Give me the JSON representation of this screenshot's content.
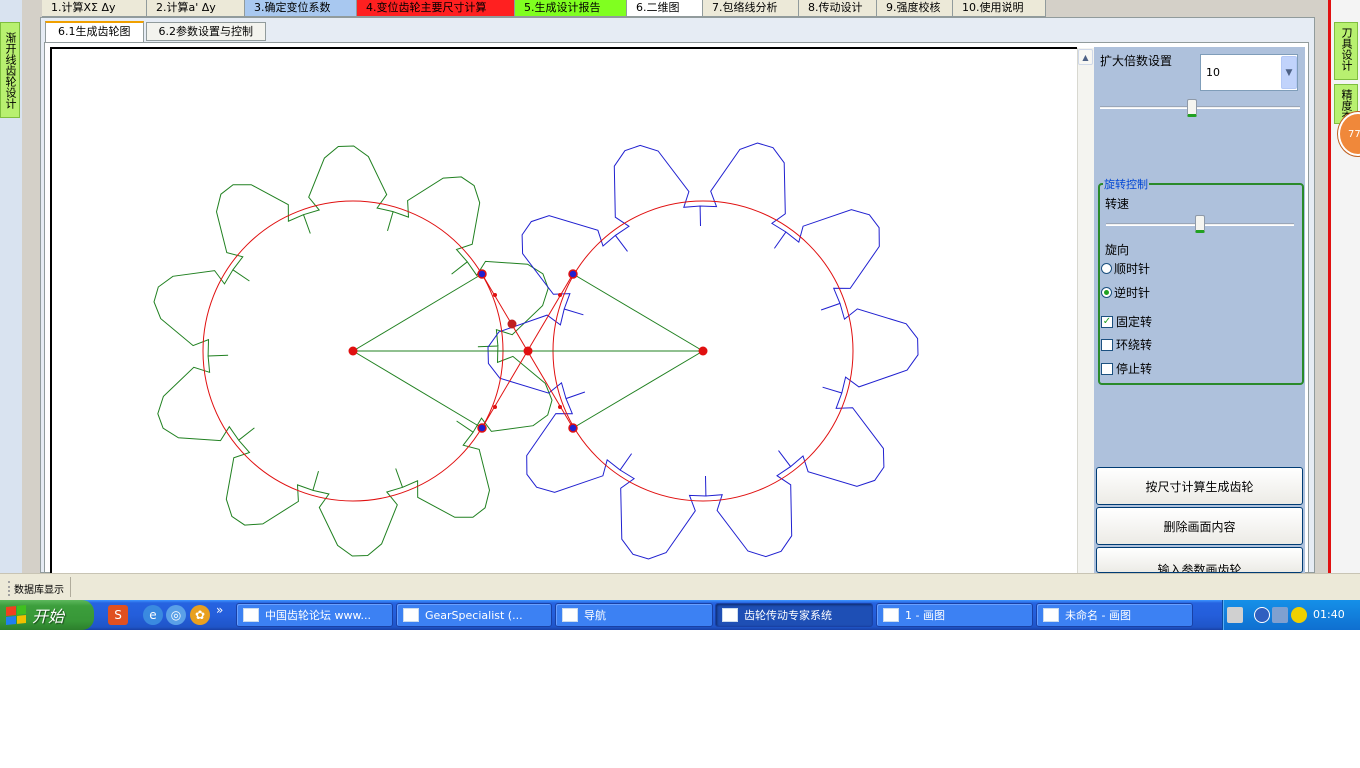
{
  "left_panel": {
    "vtab_label": "渐开线齿轮设计"
  },
  "right_panel": {
    "vtab1_label": "刀具设计",
    "vtab2_label": "精度查",
    "badge_text": "77"
  },
  "main_tabs": [
    {
      "label": "1.计算XΣ  Δy",
      "bg": "#ece9d8"
    },
    {
      "label": "2.计算a'  Δy",
      "bg": "#ece9d8"
    },
    {
      "label": "3.确定变位系数",
      "bg": "#a8c8f0"
    },
    {
      "label": "4.变位齿轮主要尺寸计算",
      "bg": "#ff2020"
    },
    {
      "label": "5.生成设计报告",
      "bg": "#80ff20"
    },
    {
      "label": "6.二维图",
      "bg": "#ffffff"
    },
    {
      "label": "7.包络线分析",
      "bg": "#ece9d8"
    },
    {
      "label": "8.传动设计",
      "bg": "#ece9d8"
    },
    {
      "label": "9.强度校核",
      "bg": "#ece9d8"
    },
    {
      "label": "10.使用说明",
      "bg": "#ece9d8"
    }
  ],
  "sub_tabs": [
    {
      "label": "6.1生成齿轮图",
      "active": true
    },
    {
      "label": "6.2参数设置与控制",
      "active": false
    }
  ],
  "controls": {
    "zoom_label": "扩大倍数设置",
    "zoom_value": "10",
    "zoom_slider_fraction": 0.46,
    "rotation_group_label": "旋转控制",
    "speed_label": "转速",
    "speed_slider_fraction": 0.5,
    "direction_label": "旋向",
    "clockwise_label": "顺时针",
    "counterclockwise_label": "逆时针",
    "direction_selected": "counterclockwise",
    "fixed_rotation_label": "固定转",
    "fixed_rotation_checked": true,
    "orbit_rotation_label": "环绕转",
    "orbit_rotation_checked": false,
    "stop_rotation_label": "停止转",
    "stop_rotation_checked": false,
    "calc_button_label": "按尺寸计算生成齿轮",
    "clear_button_label": "删除画面内容",
    "input_button_label": "输入参数画齿轮"
  },
  "drawing": {
    "gear1_color": "#208020",
    "gear2_color": "#2020d0",
    "pitch_circle_color": "#e01010",
    "gear_teeth": 10
  },
  "status_bar": {
    "text": "数据库显示"
  },
  "taskbar": {
    "start_label": "开始",
    "quicklaunch_more": "»",
    "tasks": [
      {
        "label": "中国齿轮论坛 www...",
        "active": false
      },
      {
        "label": "GearSpecialist (...",
        "active": false
      },
      {
        "label": "导航",
        "active": false
      },
      {
        "label": "齿轮传动专家系统",
        "active": true
      },
      {
        "label": "1 - 画图",
        "active": false
      },
      {
        "label": "未命名 - 画图",
        "active": false
      }
    ],
    "clock": "01:40"
  }
}
